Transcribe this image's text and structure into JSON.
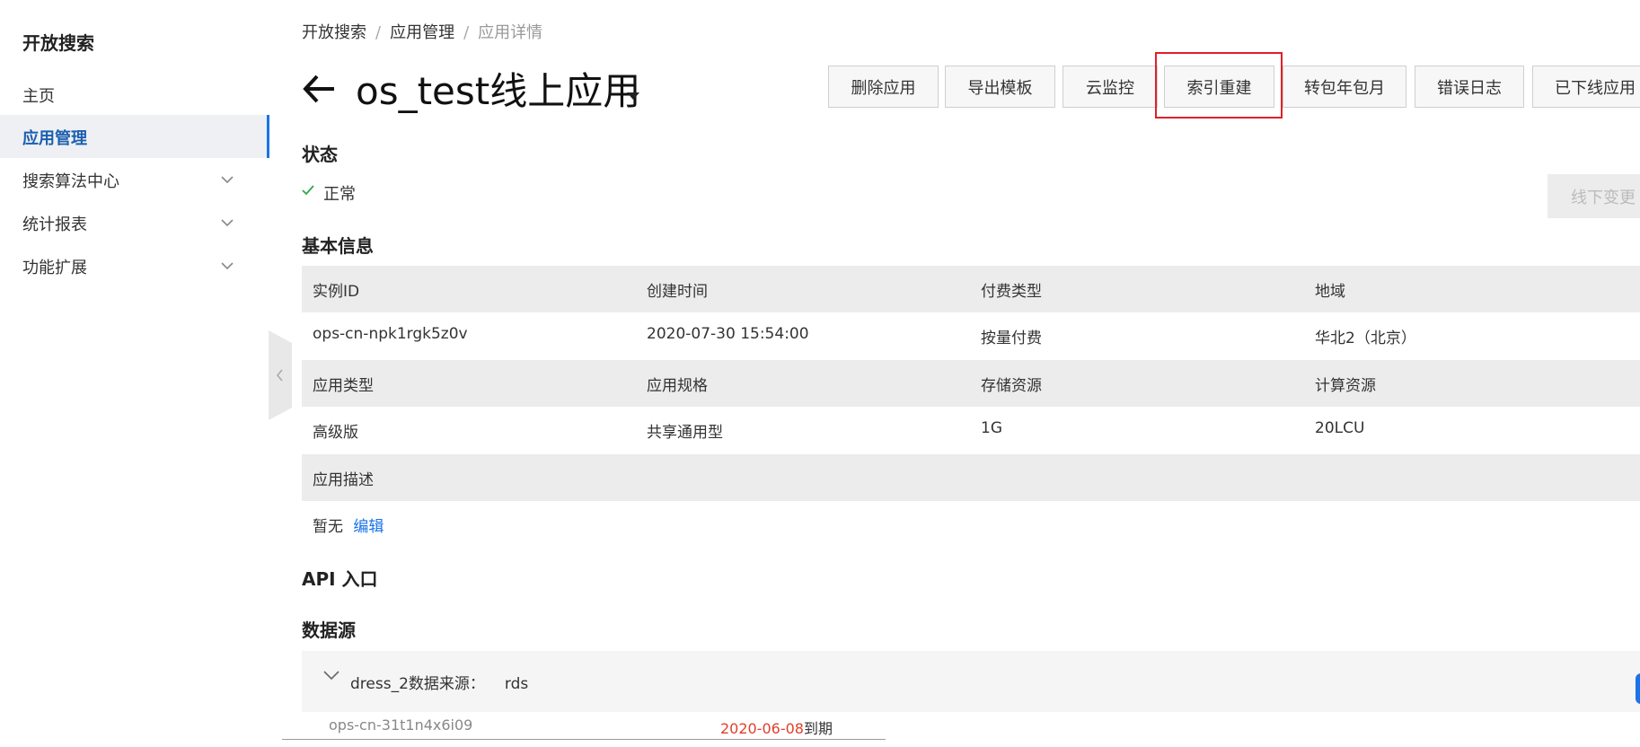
{
  "sidebar": {
    "title": "开放搜索",
    "items": [
      {
        "label": "主页"
      },
      {
        "label": "应用管理"
      },
      {
        "label": "搜索算法中心"
      },
      {
        "label": "统计报表"
      },
      {
        "label": "功能扩展"
      }
    ]
  },
  "breadcrumb": [
    "开放搜索",
    "应用管理",
    "应用详情"
  ],
  "header": {
    "title": "os_test线上应用",
    "buttons": [
      "删除应用",
      "导出模板",
      "云监控",
      "索引重建",
      "转包年包月",
      "错误日志",
      "已下线应用"
    ]
  },
  "status": {
    "title": "状态",
    "value": "正常",
    "offline_button": "线下变更"
  },
  "basic_info": {
    "title": "基本信息",
    "rows": [
      [
        "实例ID",
        "创建时间",
        "付费类型",
        "地域"
      ],
      [
        "ops-cn-npk1rgk5z0v",
        "2020-07-30 15:54:00",
        "按量付费",
        "华北2（北京）"
      ],
      [
        "应用类型",
        "应用规格",
        "存储资源",
        "计算资源"
      ],
      [
        "高级版",
        "共享通用型",
        "1G",
        "20LCU"
      ],
      [
        "应用描述"
      ]
    ],
    "description": {
      "value": "暂无",
      "edit_label": "编辑"
    }
  },
  "api": {
    "title": "API 入口"
  },
  "datasource": {
    "title": "数据源",
    "item_name": "dress_2数据来源：",
    "item_type": "rds",
    "sub_instance": "ops-cn-31t1n4x6i09",
    "sub_date": "2020-06-08",
    "sub_suffix": "到期"
  },
  "colors": {
    "accent": "#1a73e8",
    "highlight": "#e0202a",
    "expire": "#e0402a",
    "success": "#2aa845"
  }
}
